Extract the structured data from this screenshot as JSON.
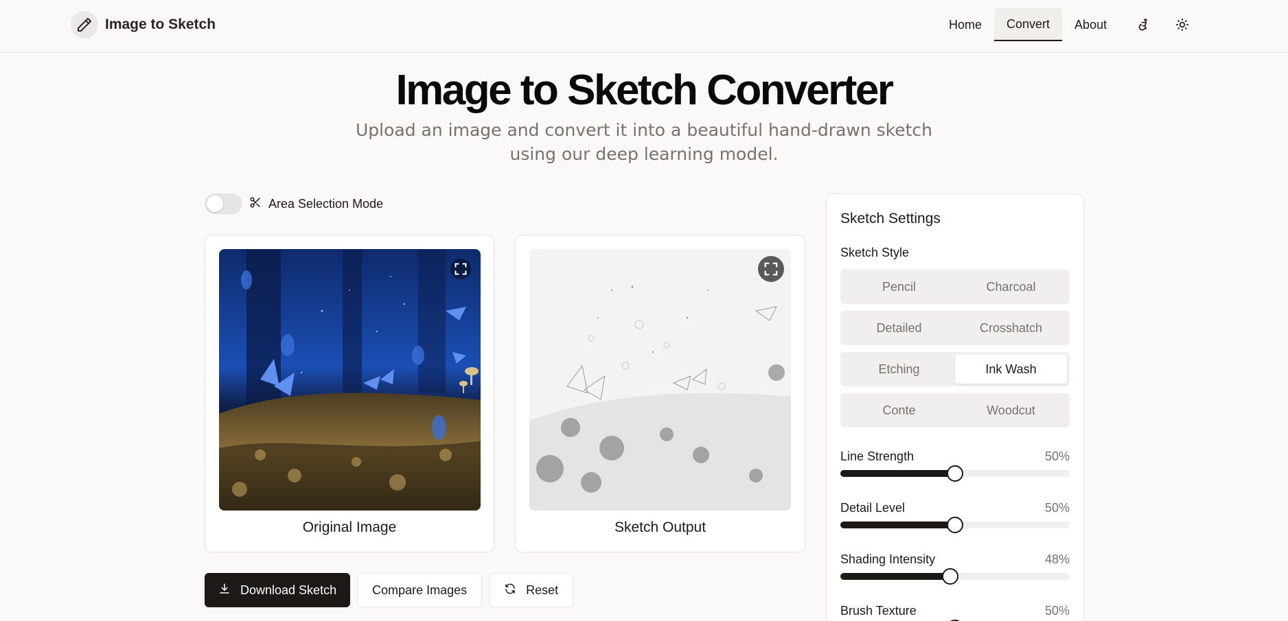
{
  "header": {
    "brand_title": "Image to Sketch",
    "nav": [
      {
        "label": "Home",
        "active": false
      },
      {
        "label": "Convert",
        "active": true
      },
      {
        "label": "About",
        "active": false
      }
    ],
    "icons": [
      "accessibility-icon",
      "sun-icon"
    ]
  },
  "hero": {
    "title": "Image to Sketch Converter",
    "subtitle": "Upload an image and convert it into a beautiful hand-drawn sketch using our deep learning model."
  },
  "area_selection": {
    "label": "Area Selection Mode",
    "enabled": false
  },
  "original_card": {
    "caption": "Original Image"
  },
  "sketch_card": {
    "caption": "Sketch Output"
  },
  "actions": {
    "download": "Download Sketch",
    "compare": "Compare Images",
    "reset": "Reset"
  },
  "settings": {
    "title": "Sketch Settings",
    "style_label": "Sketch Style",
    "styles": [
      [
        "Pencil",
        "Charcoal"
      ],
      [
        "Detailed",
        "Crosshatch"
      ],
      [
        "Etching",
        "Ink Wash"
      ],
      [
        "Conte",
        "Woodcut"
      ]
    ],
    "selected_style": "Ink Wash",
    "sliders": [
      {
        "name": "Line Strength",
        "value": "50%",
        "fraction": 0.5
      },
      {
        "name": "Detail Level",
        "value": "50%",
        "fraction": 0.5
      },
      {
        "name": "Shading Intensity",
        "value": "48%",
        "fraction": 0.48
      },
      {
        "name": "Brush Texture",
        "value": "50%",
        "fraction": 0.5
      }
    ]
  },
  "colors": {
    "background": "#faf9f7",
    "primary": "#1c1917",
    "muted_text": "#78716c"
  }
}
